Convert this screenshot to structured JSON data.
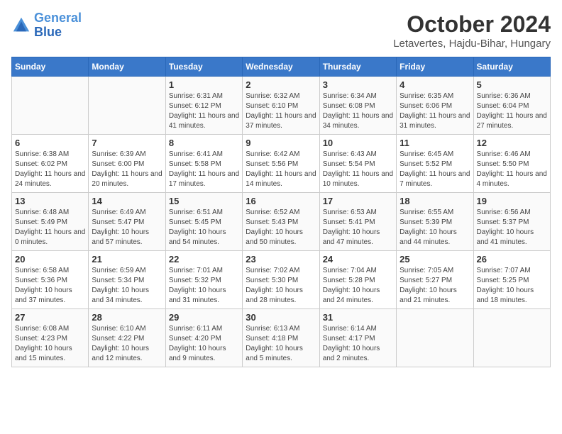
{
  "header": {
    "logo_line1": "General",
    "logo_line2": "Blue",
    "month": "October 2024",
    "location": "Letavertes, Hajdu-Bihar, Hungary"
  },
  "columns": [
    "Sunday",
    "Monday",
    "Tuesday",
    "Wednesday",
    "Thursday",
    "Friday",
    "Saturday"
  ],
  "weeks": [
    [
      {
        "day": "",
        "info": ""
      },
      {
        "day": "",
        "info": ""
      },
      {
        "day": "1",
        "info": "Sunrise: 6:31 AM\nSunset: 6:12 PM\nDaylight: 11 hours and 41 minutes."
      },
      {
        "day": "2",
        "info": "Sunrise: 6:32 AM\nSunset: 6:10 PM\nDaylight: 11 hours and 37 minutes."
      },
      {
        "day": "3",
        "info": "Sunrise: 6:34 AM\nSunset: 6:08 PM\nDaylight: 11 hours and 34 minutes."
      },
      {
        "day": "4",
        "info": "Sunrise: 6:35 AM\nSunset: 6:06 PM\nDaylight: 11 hours and 31 minutes."
      },
      {
        "day": "5",
        "info": "Sunrise: 6:36 AM\nSunset: 6:04 PM\nDaylight: 11 hours and 27 minutes."
      }
    ],
    [
      {
        "day": "6",
        "info": "Sunrise: 6:38 AM\nSunset: 6:02 PM\nDaylight: 11 hours and 24 minutes."
      },
      {
        "day": "7",
        "info": "Sunrise: 6:39 AM\nSunset: 6:00 PM\nDaylight: 11 hours and 20 minutes."
      },
      {
        "day": "8",
        "info": "Sunrise: 6:41 AM\nSunset: 5:58 PM\nDaylight: 11 hours and 17 minutes."
      },
      {
        "day": "9",
        "info": "Sunrise: 6:42 AM\nSunset: 5:56 PM\nDaylight: 11 hours and 14 minutes."
      },
      {
        "day": "10",
        "info": "Sunrise: 6:43 AM\nSunset: 5:54 PM\nDaylight: 11 hours and 10 minutes."
      },
      {
        "day": "11",
        "info": "Sunrise: 6:45 AM\nSunset: 5:52 PM\nDaylight: 11 hours and 7 minutes."
      },
      {
        "day": "12",
        "info": "Sunrise: 6:46 AM\nSunset: 5:50 PM\nDaylight: 11 hours and 4 minutes."
      }
    ],
    [
      {
        "day": "13",
        "info": "Sunrise: 6:48 AM\nSunset: 5:49 PM\nDaylight: 11 hours and 0 minutes."
      },
      {
        "day": "14",
        "info": "Sunrise: 6:49 AM\nSunset: 5:47 PM\nDaylight: 10 hours and 57 minutes."
      },
      {
        "day": "15",
        "info": "Sunrise: 6:51 AM\nSunset: 5:45 PM\nDaylight: 10 hours and 54 minutes."
      },
      {
        "day": "16",
        "info": "Sunrise: 6:52 AM\nSunset: 5:43 PM\nDaylight: 10 hours and 50 minutes."
      },
      {
        "day": "17",
        "info": "Sunrise: 6:53 AM\nSunset: 5:41 PM\nDaylight: 10 hours and 47 minutes."
      },
      {
        "day": "18",
        "info": "Sunrise: 6:55 AM\nSunset: 5:39 PM\nDaylight: 10 hours and 44 minutes."
      },
      {
        "day": "19",
        "info": "Sunrise: 6:56 AM\nSunset: 5:37 PM\nDaylight: 10 hours and 41 minutes."
      }
    ],
    [
      {
        "day": "20",
        "info": "Sunrise: 6:58 AM\nSunset: 5:36 PM\nDaylight: 10 hours and 37 minutes."
      },
      {
        "day": "21",
        "info": "Sunrise: 6:59 AM\nSunset: 5:34 PM\nDaylight: 10 hours and 34 minutes."
      },
      {
        "day": "22",
        "info": "Sunrise: 7:01 AM\nSunset: 5:32 PM\nDaylight: 10 hours and 31 minutes."
      },
      {
        "day": "23",
        "info": "Sunrise: 7:02 AM\nSunset: 5:30 PM\nDaylight: 10 hours and 28 minutes."
      },
      {
        "day": "24",
        "info": "Sunrise: 7:04 AM\nSunset: 5:28 PM\nDaylight: 10 hours and 24 minutes."
      },
      {
        "day": "25",
        "info": "Sunrise: 7:05 AM\nSunset: 5:27 PM\nDaylight: 10 hours and 21 minutes."
      },
      {
        "day": "26",
        "info": "Sunrise: 7:07 AM\nSunset: 5:25 PM\nDaylight: 10 hours and 18 minutes."
      }
    ],
    [
      {
        "day": "27",
        "info": "Sunrise: 6:08 AM\nSunset: 4:23 PM\nDaylight: 10 hours and 15 minutes."
      },
      {
        "day": "28",
        "info": "Sunrise: 6:10 AM\nSunset: 4:22 PM\nDaylight: 10 hours and 12 minutes."
      },
      {
        "day": "29",
        "info": "Sunrise: 6:11 AM\nSunset: 4:20 PM\nDaylight: 10 hours and 9 minutes."
      },
      {
        "day": "30",
        "info": "Sunrise: 6:13 AM\nSunset: 4:18 PM\nDaylight: 10 hours and 5 minutes."
      },
      {
        "day": "31",
        "info": "Sunrise: 6:14 AM\nSunset: 4:17 PM\nDaylight: 10 hours and 2 minutes."
      },
      {
        "day": "",
        "info": ""
      },
      {
        "day": "",
        "info": ""
      }
    ]
  ]
}
